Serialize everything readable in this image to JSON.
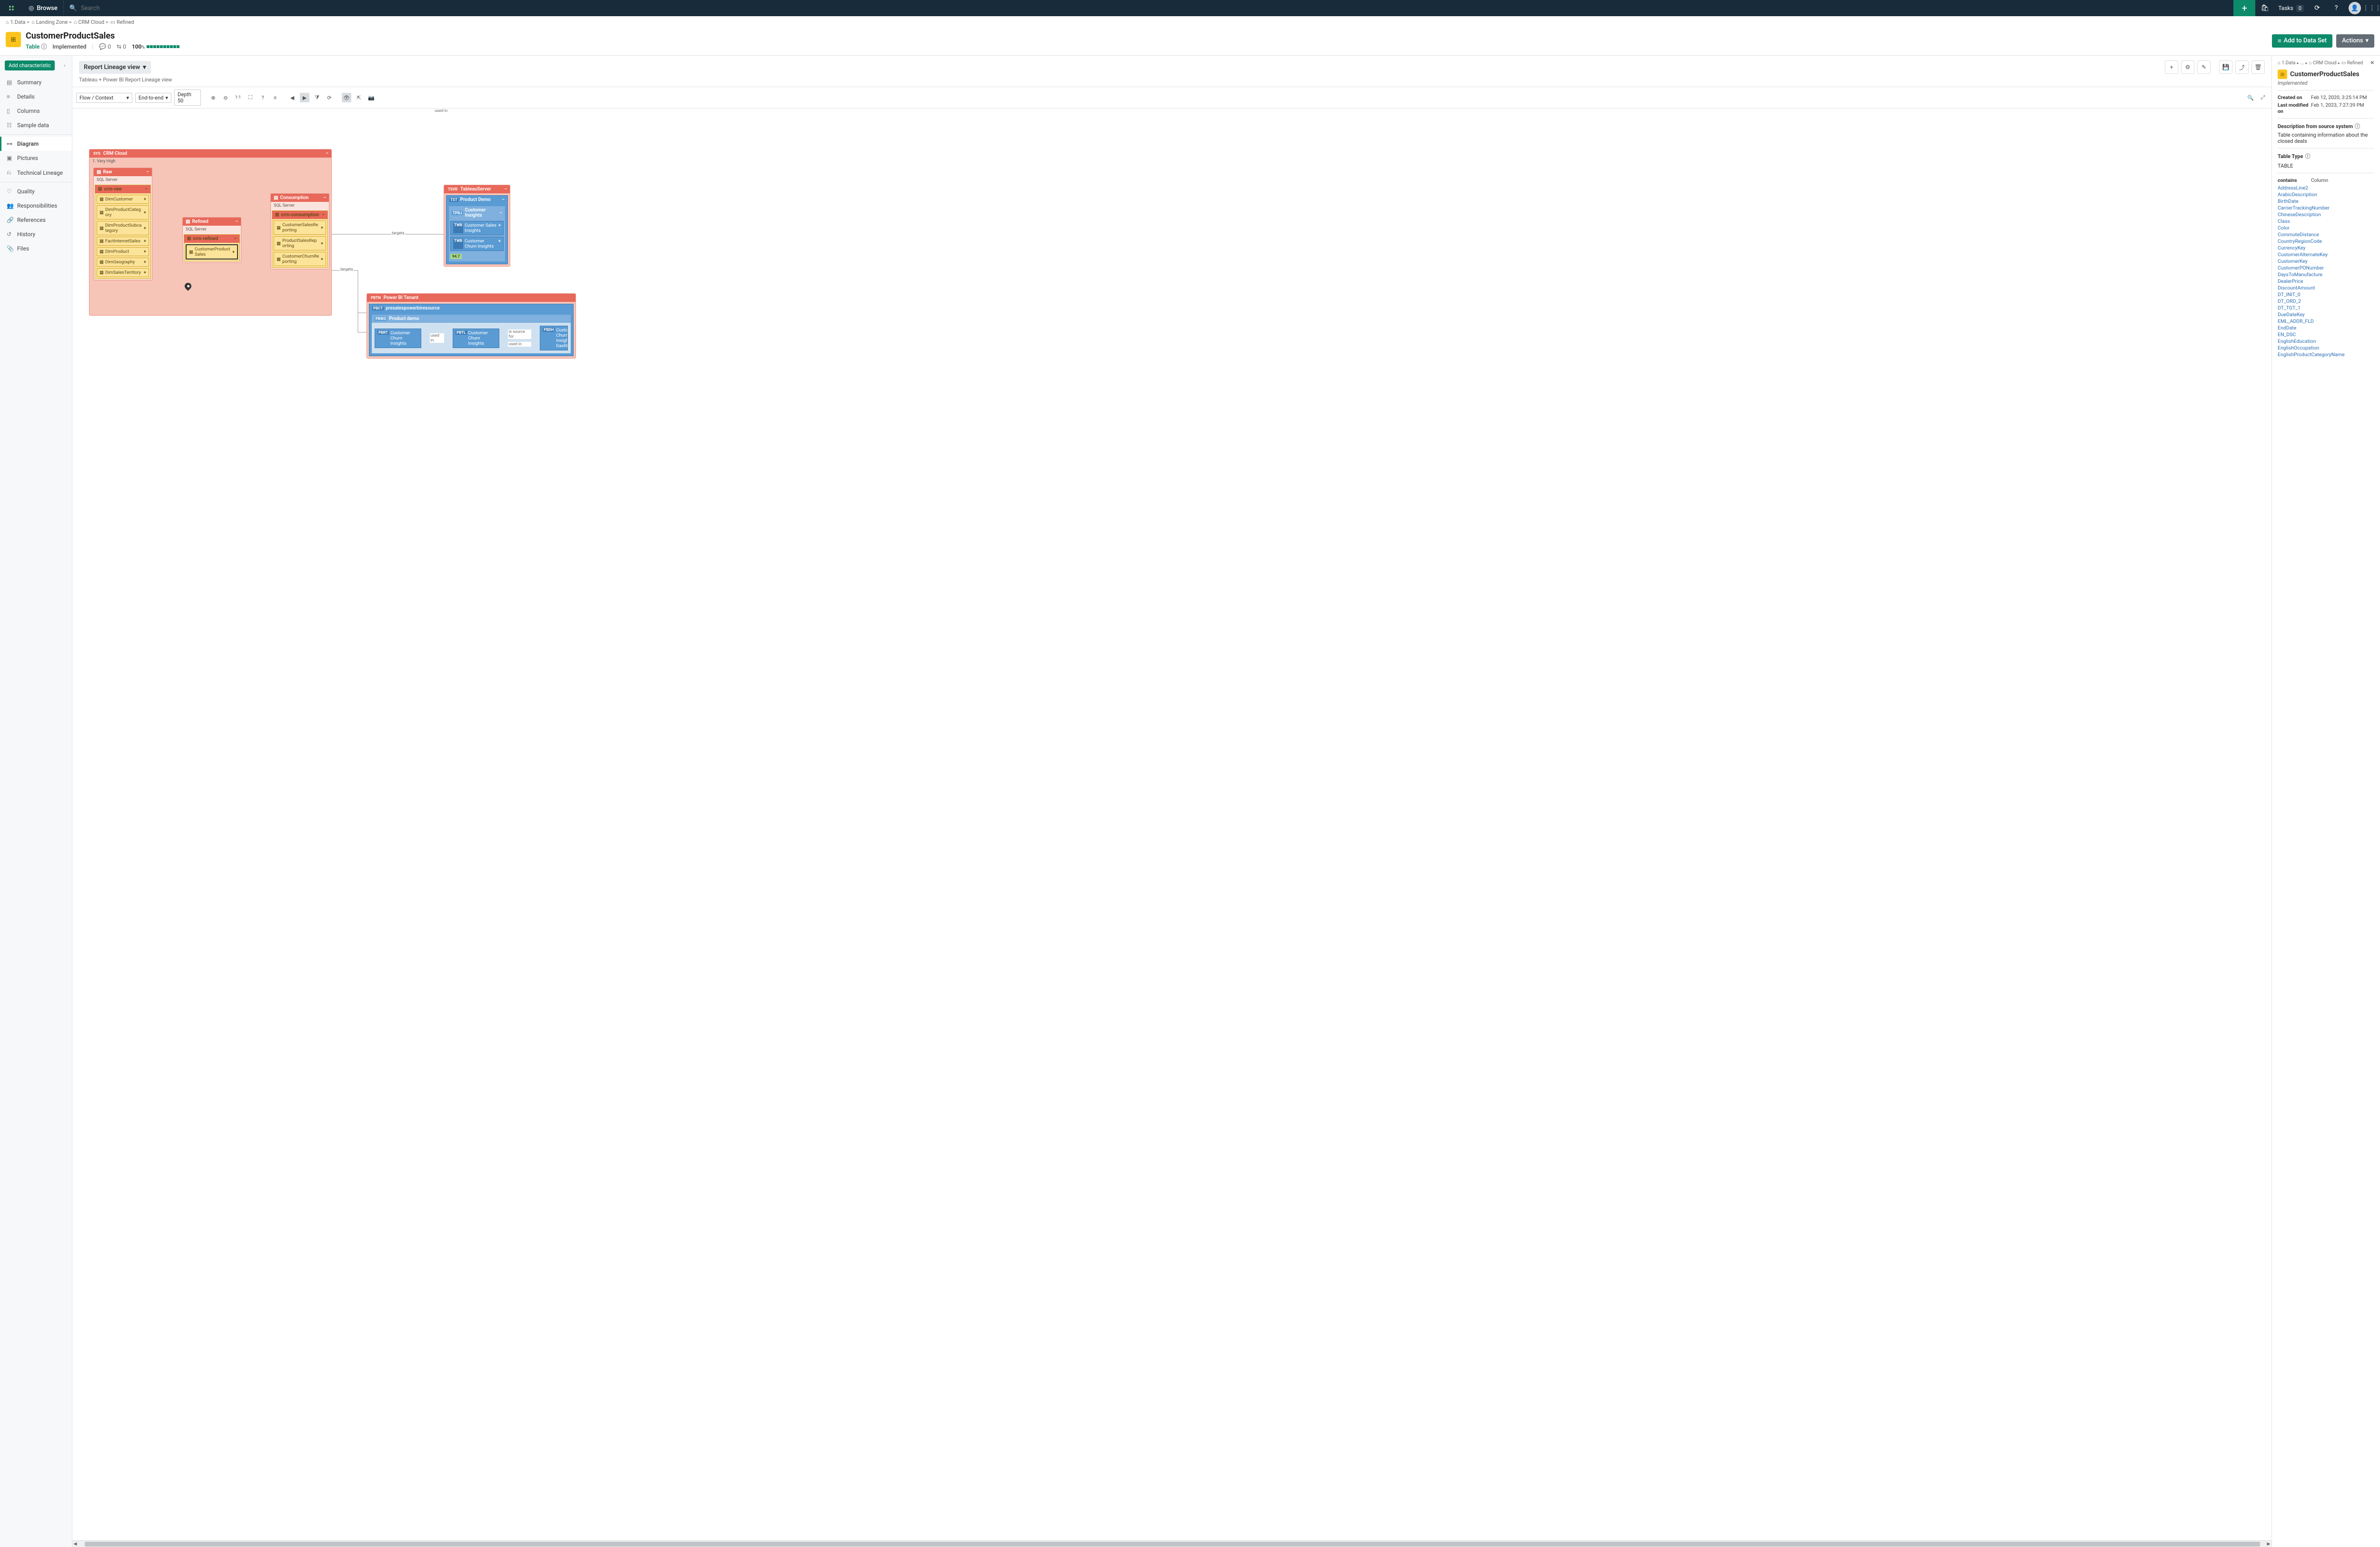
{
  "topnav": {
    "browse": "Browse",
    "search_placeholder": "Search",
    "tasks_label": "Tasks",
    "tasks_count": "0"
  },
  "breadcrumbs": [
    {
      "icon": "home",
      "label": "1.Data"
    },
    {
      "icon": "home",
      "label": "Landing Zone"
    },
    {
      "icon": "home",
      "label": "CRM Cloud"
    },
    {
      "icon": "refined",
      "label": "Refined"
    }
  ],
  "asset": {
    "title": "CustomerProductSales",
    "type": "Table",
    "status": "Implemented",
    "comments": "0",
    "links": "0",
    "score": "100",
    "score_unit": "%",
    "add_to_dataset": "Add to Data Set",
    "actions": "Actions"
  },
  "leftnav": {
    "add_char": "Add characteristic",
    "items": [
      {
        "icon": "summary",
        "label": "Summary"
      },
      {
        "icon": "details",
        "label": "Details"
      },
      {
        "icon": "columns",
        "label": "Columns"
      },
      {
        "icon": "sample",
        "label": "Sample data"
      },
      {
        "icon": "diagram",
        "label": "Diagram",
        "active": true
      },
      {
        "icon": "pictures",
        "label": "Pictures"
      },
      {
        "icon": "tech",
        "label": "Technical Lineage"
      },
      {
        "icon": "quality",
        "label": "Quality"
      },
      {
        "icon": "resp",
        "label": "Responsibilities"
      },
      {
        "icon": "refs",
        "label": "References"
      },
      {
        "icon": "history",
        "label": "History"
      },
      {
        "icon": "files",
        "label": "Files"
      }
    ]
  },
  "view": {
    "name": "Report Lineage view",
    "subtitle": "Tableau + Power BI Report Lineage view"
  },
  "dtoolbar": {
    "flow": "Flow / Context",
    "end": "End-to-end",
    "depth": "Depth 50",
    "oneone": "1:1"
  },
  "diagram": {
    "crm_cloud": {
      "tag": "SYS",
      "label": "CRM Cloud",
      "sub": "1. Very High"
    },
    "raw": {
      "label": "Raw",
      "db": "SQL Server",
      "schema": "crm-raw",
      "tables": [
        "DimCustomer",
        "DimProductCategory",
        "DimProductSubcategory",
        "FactInternetSales",
        "DimProduct",
        "DimGeography",
        "DimSalesTerritory"
      ]
    },
    "refined": {
      "label": "Refined",
      "db": "SQL Server",
      "schema": "crm-refined",
      "tables": [
        "CustomerProductSales"
      ]
    },
    "consumption": {
      "label": "Consumption",
      "db": "SQL Server",
      "schema": "crm-consumption",
      "tables": [
        "CustomerSalesReporting",
        "ProductSalesReporting",
        "CustomerChurnReporting"
      ]
    },
    "tableau": {
      "tag": "TSVR",
      "label": "TableauServer",
      "site_tag": "TST",
      "site": "Product Demo",
      "prj_tag": "TPRJ",
      "prj": "Customer Insights",
      "wb1": "Customer Sales Insights",
      "wb2": "Customer Churn Insights",
      "wb_tag": "TWB",
      "badge": "94.7"
    },
    "powerbi": {
      "tag": "PBTN",
      "label": "Power BI Tenant",
      "cap_tag": "PBCT",
      "cap": "presalespowerbiresource",
      "ws_tag": "PBWS",
      "ws": "Product demo",
      "rt_tag": "PBRT",
      "rt": "Customer Churn Insights",
      "tl_tag": "PBTL",
      "tl": "Customer Churn Insights",
      "dh_tag": "PBDH",
      "dh": "Customer Churn Insights Dashboard"
    },
    "edges": {
      "targets": "targets",
      "used_in": "used in",
      "is_source_for": "is source for"
    }
  },
  "rightpanel": {
    "crumbs": [
      "1.Data",
      "...",
      "CRM Cloud",
      "Refined"
    ],
    "title": "CustomerProductSales",
    "status": "Implemented",
    "created_label": "Created on",
    "created": "Feb 12, 2020, 3:25:14 PM",
    "modified_label": "Last modified on",
    "modified": "Feb 1, 2023, 7:27:39 PM",
    "desc_head": "Description from source system",
    "desc": "Table containing information about the closed deals",
    "tt_label": "Table Type",
    "tt_value": "TABLE",
    "contains_label": "contains",
    "contains_type": "Column",
    "columns": [
      "AddressLine2",
      "ArabicDescription",
      "BirthDate",
      "CarrierTrackingNumber",
      "ChineseDescription",
      "Class",
      "Color",
      "CommuteDistance",
      "CountryRegionCode",
      "CurrencyKey",
      "CustomerAlternateKey",
      "CustomerKey",
      "CustomerPONumber",
      "DaysToManufacture",
      "DealerPrice",
      "DiscountAmount",
      "DT_INIT_0",
      "DT_ORD_2",
      "DT_TGT_1",
      "DueDateKey",
      "EML_ADDR_FLD",
      "EndDate",
      "EN_DSC",
      "EnglishEducation",
      "EnglishOccupation",
      "EnglishProductCategoryName"
    ]
  }
}
